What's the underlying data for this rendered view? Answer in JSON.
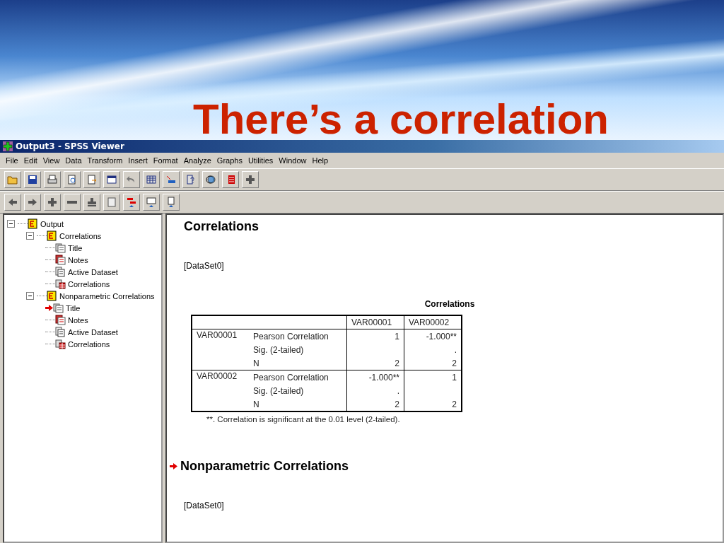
{
  "slide_title": "There’s a correlation",
  "window": {
    "title": "Output3 - SPSS Viewer"
  },
  "menu": [
    "File",
    "Edit",
    "View",
    "Data",
    "Transform",
    "Insert",
    "Format",
    "Analyze",
    "Graphs",
    "Utilities",
    "Window",
    "Help"
  ],
  "tree": [
    {
      "label": "Output",
      "kind": "book",
      "expanded": true,
      "marked": false,
      "children": [
        {
          "label": "Correlations",
          "kind": "book",
          "expanded": true,
          "marked": false,
          "children": [
            {
              "label": "Title",
              "kind": "title",
              "marked": false
            },
            {
              "label": "Notes",
              "kind": "notes",
              "marked": false
            },
            {
              "label": "Active Dataset",
              "kind": "dataset",
              "marked": false
            },
            {
              "label": "Correlations",
              "kind": "table",
              "marked": false
            }
          ]
        },
        {
          "label": "Nonparametric Correlations",
          "kind": "book",
          "expanded": true,
          "marked": false,
          "children": [
            {
              "label": "Title",
              "kind": "title",
              "marked": true
            },
            {
              "label": "Notes",
              "kind": "notes",
              "marked": false
            },
            {
              "label": "Active Dataset",
              "kind": "dataset",
              "marked": false
            },
            {
              "label": "Correlations",
              "kind": "table",
              "marked": false
            }
          ]
        }
      ]
    }
  ],
  "output": [
    {
      "kind": "heading",
      "text": "Correlations",
      "marked": false
    },
    {
      "kind": "dataset",
      "text": "[DataSet0]"
    },
    {
      "kind": "table",
      "title": "Correlations",
      "columns": [
        "VAR00001",
        "VAR00002"
      ],
      "groups": [
        {
          "variable": "VAR00001",
          "rows": [
            {
              "label": "Pearson Correlation",
              "column_1": "1",
              "column_2": "-1.000**"
            },
            {
              "label": "Sig. (2-tailed)",
              "column_2": "."
            },
            {
              "label": "N",
              "column_1": "2",
              "column_2": "2"
            }
          ]
        },
        {
          "variable": "VAR00002",
          "rows": [
            {
              "label": "Pearson Correlation",
              "column_1": "-1.000**",
              "column_2": "1"
            },
            {
              "label": "Sig. (2-tailed)",
              "column_1": "."
            },
            {
              "label": "N",
              "column_1": "2",
              "column_2": "2"
            }
          ]
        }
      ],
      "footnote": "**. Correlation is significant at the 0.01 level (2-tailed)."
    },
    {
      "kind": "heading",
      "text": "Nonparametric Correlations",
      "marked": true
    },
    {
      "kind": "dataset",
      "text": "[DataSet0]"
    }
  ]
}
